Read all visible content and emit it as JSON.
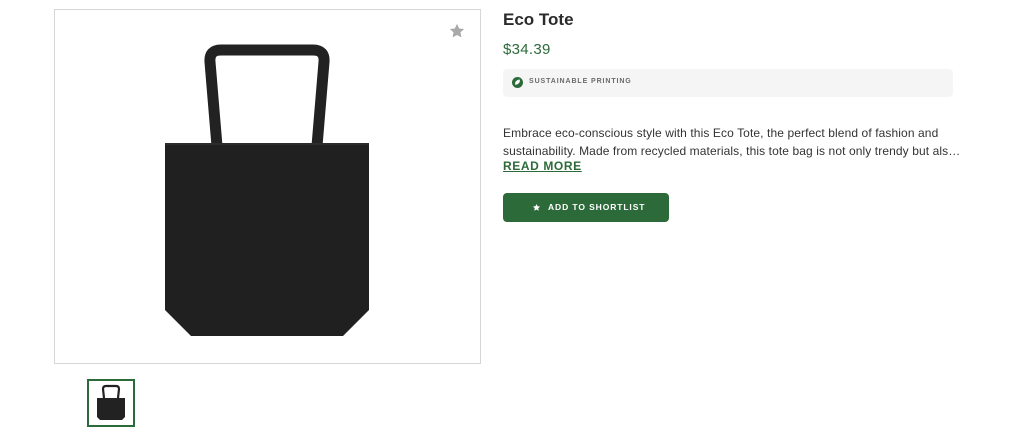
{
  "gallery": {
    "favorite_icon": "star-icon",
    "main_image_alt": "black tote bag",
    "thumbnails": [
      {
        "icon": "tote-thumbnail",
        "selected": true
      }
    ]
  },
  "product": {
    "title": "Eco Tote",
    "price": "$34.39",
    "badge": {
      "icon": "leaf-icon",
      "label": "SUSTAINABLE PRINTING"
    },
    "description_lines": [
      "Embrace eco-conscious style with this Eco Tote, the perfect blend of fashion and",
      "sustainability. Made from recycled materials, this tote bag is not only trendy but als…"
    ],
    "read_more": "READ MORE",
    "shortlist_button": {
      "icon": "star-icon",
      "label": "ADD TO SHORTLIST"
    }
  },
  "colors": {
    "accent": "#2d6a3a",
    "bag": "#202020",
    "badge_bg": "#f5f5f5"
  }
}
